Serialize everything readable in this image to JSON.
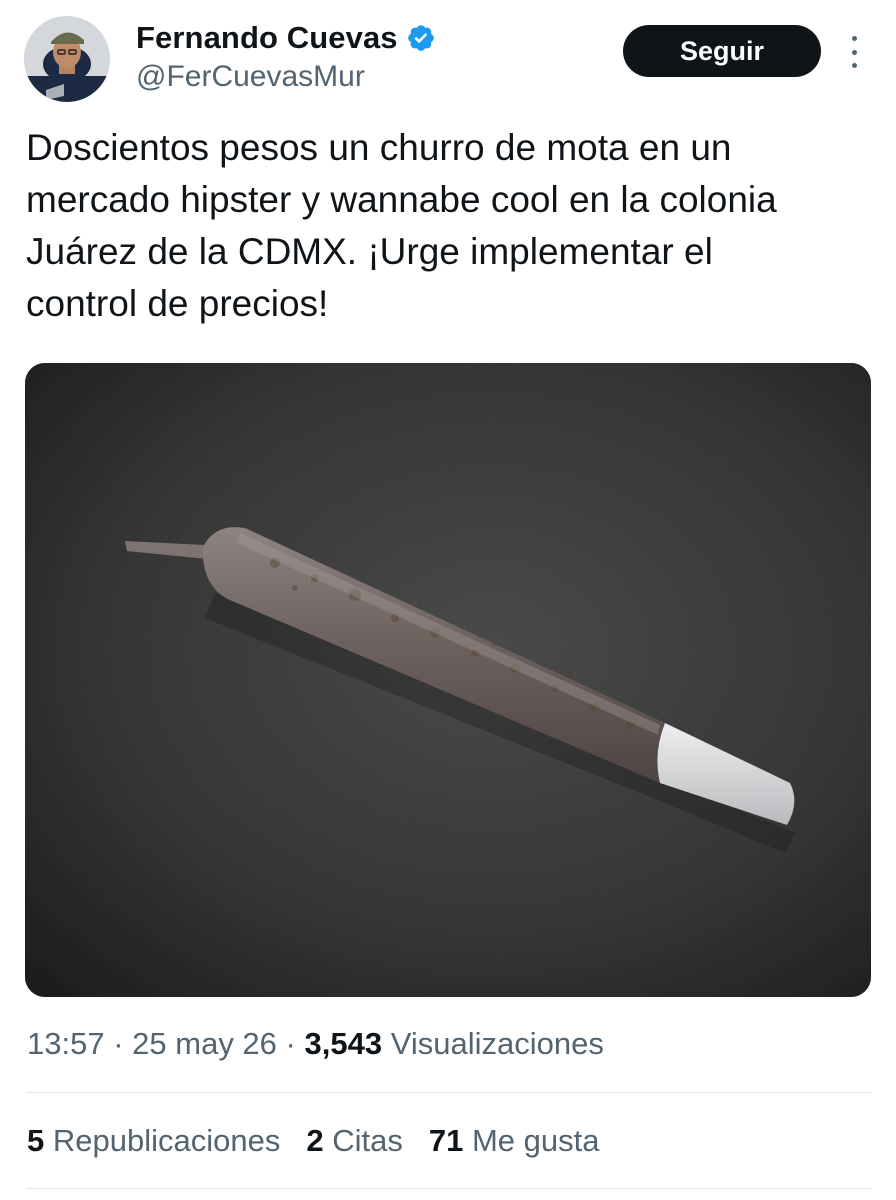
{
  "header": {
    "display_name": "Fernando Cuevas",
    "handle": "@FerCuevasMur",
    "follow_label": "Seguir",
    "verified_icon": "verified-badge-icon",
    "more_icon": "more-vertical-icon"
  },
  "tweet": {
    "text": "Doscientos pesos un churro de mota en un\nmercado hipster y wannabe cool en la colonia\nJuárez de la CDMX. ¡Urge implementar el\ncontrol de precios!"
  },
  "meta": {
    "time": "13:57",
    "separator": "·",
    "date": "25 may 26",
    "views_count": "3,543",
    "views_label": "Visualizaciones"
  },
  "stats": {
    "reposts_count": "5",
    "reposts_label": "Republicaciones",
    "quotes_count": "2",
    "quotes_label": "Citas",
    "likes_count": "71",
    "likes_label": "Me gusta"
  },
  "colors": {
    "text_primary": "#0f1419",
    "text_secondary": "#536471",
    "verified_blue": "#1d9bf0",
    "button_bg": "#0f1419",
    "divider": "#e1e5e8"
  }
}
